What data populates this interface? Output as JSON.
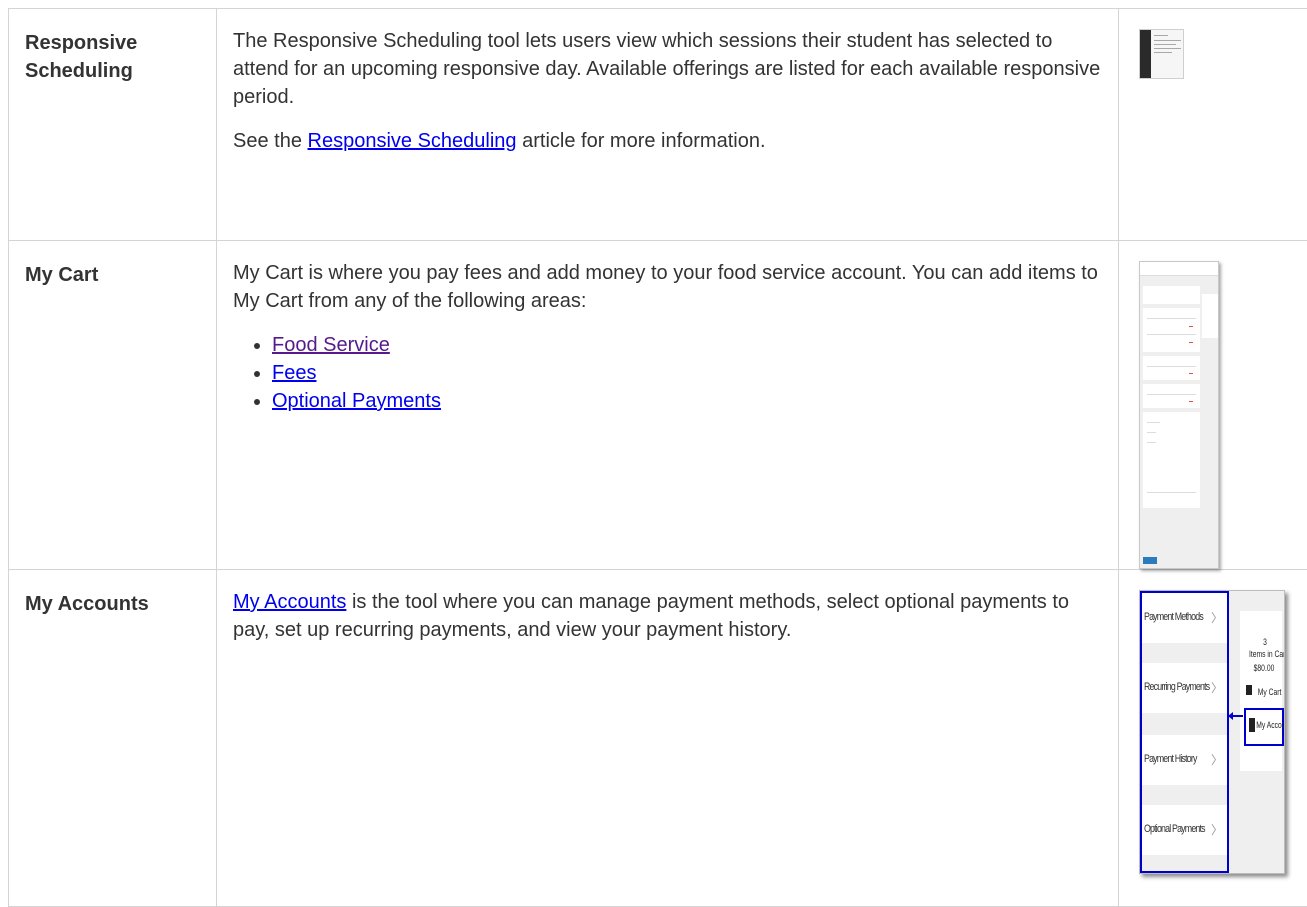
{
  "rows": [
    {
      "term": "Responsive Scheduling",
      "paragraph": "The Responsive Scheduling tool lets users view which sessions their student has selected to attend for an upcoming responsive day. Available offerings are listed for each available responsive period.",
      "see_prefix": "See the ",
      "see_link": "Responsive Scheduling",
      "see_suffix": " article for more information."
    },
    {
      "term": "My Cart",
      "paragraph": "My Cart is where you pay fees and add money to your food service account. You can add items to My Cart from any of the following areas:",
      "links": [
        "Food Service",
        "Fees",
        "Optional Payments"
      ]
    },
    {
      "term": "My Accounts",
      "link": "My Accounts",
      "paragraph": " is the tool where you can manage payment methods, select optional payments to pay, set up recurring payments, and view your payment history.",
      "thumb": {
        "items": [
          "Payment Methods",
          "Recurring Payments",
          "Payment History",
          "Optional Payments"
        ],
        "count": "3",
        "count_label": "Items in Cart",
        "total": "$80.00",
        "cart_label": "My Cart",
        "accounts_label": "My Accounts"
      }
    }
  ],
  "colors": {
    "link": "#0000ee",
    "visited_link": "#551a8b",
    "border": "#d4d4d4",
    "highlight": "#0000cc"
  }
}
